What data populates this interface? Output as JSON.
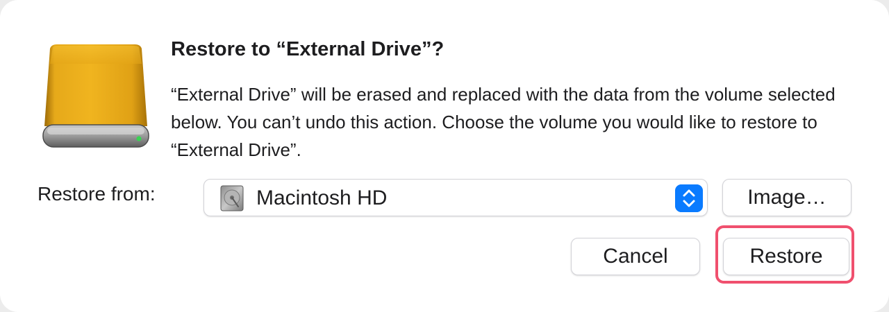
{
  "dialog": {
    "title": "Restore to “External Drive”?",
    "message": "“External Drive” will be erased and replaced with the data from the volume selected below. You can’t undo this action. Choose the volume you would like to restore to “External Drive”.",
    "icon": "external-drive-icon",
    "icon_color": "#e3a514"
  },
  "restore_from": {
    "label": "Restore from:",
    "selected_value": "Macintosh HD",
    "icon": "internal-disk-icon",
    "stepper_color": "#0a7bff"
  },
  "buttons": {
    "image_label": "Image…",
    "cancel_label": "Cancel",
    "restore_label": "Restore"
  },
  "annotation": {
    "highlight_color": "#f0506e",
    "highlighted": "restore-button"
  }
}
